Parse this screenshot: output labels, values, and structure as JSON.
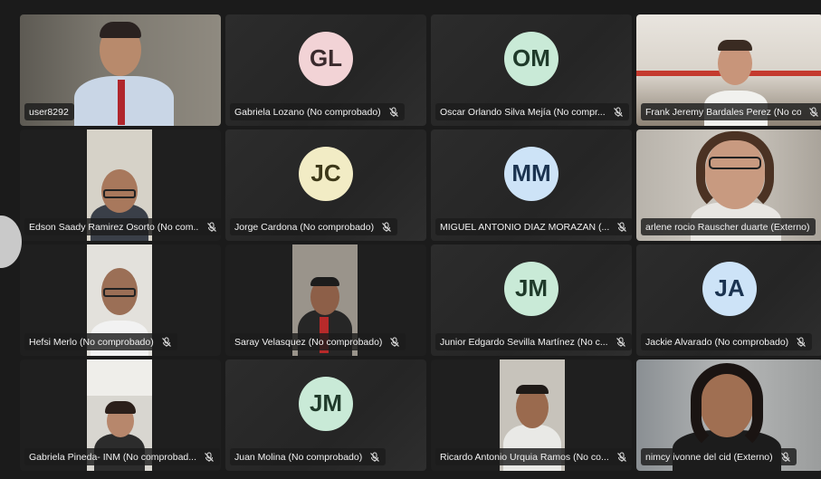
{
  "meeting": {
    "participants": [
      {
        "name": "user8292",
        "initials": "",
        "muted": false,
        "type": "video"
      },
      {
        "name": "Gabriela Lozano (No comprobado)",
        "initials": "GL",
        "muted": true,
        "type": "avatar",
        "avatar_bg": "#f2d3d6",
        "avatar_fg": "#3a2a2d"
      },
      {
        "name": "Oscar Orlando Silva Mejía (No compr...",
        "initials": "OM",
        "muted": true,
        "type": "avatar",
        "avatar_bg": "#c9ead7",
        "avatar_fg": "#1f3a2a"
      },
      {
        "name": "Frank Jeremy Bardales Perez (No com...",
        "initials": "",
        "muted": true,
        "type": "video"
      },
      {
        "name": "Edson Saady Ramirez Osorto (No com...",
        "initials": "",
        "muted": true,
        "type": "video"
      },
      {
        "name": "Jorge Cardona (No comprobado)",
        "initials": "JC",
        "muted": true,
        "type": "avatar",
        "avatar_bg": "#f2ecc5",
        "avatar_fg": "#3d3819"
      },
      {
        "name": "MIGUEL ANTONIO DIAZ MORAZAN (...",
        "initials": "MM",
        "muted": true,
        "type": "avatar",
        "avatar_bg": "#cde3f7",
        "avatar_fg": "#1b3350"
      },
      {
        "name": "arlene rocio Rauscher duarte (Externo)",
        "initials": "",
        "muted": false,
        "type": "video"
      },
      {
        "name": "Hefsi Merlo (No comprobado)",
        "initials": "",
        "muted": true,
        "type": "video"
      },
      {
        "name": "Saray Velasquez (No comprobado)",
        "initials": "",
        "muted": true,
        "type": "video"
      },
      {
        "name": "Junior Edgardo Sevilla Martínez (No c...",
        "initials": "JM",
        "muted": true,
        "type": "avatar",
        "avatar_bg": "#c9ead7",
        "avatar_fg": "#1f3a2a"
      },
      {
        "name": "Jackie Alvarado (No comprobado)",
        "initials": "JA",
        "muted": true,
        "type": "avatar",
        "avatar_bg": "#cde3f7",
        "avatar_fg": "#1b3350"
      },
      {
        "name": "Gabriela Pineda- INM (No comprobad...",
        "initials": "",
        "muted": true,
        "type": "video"
      },
      {
        "name": "Juan Molina (No comprobado)",
        "initials": "JM",
        "muted": true,
        "type": "avatar",
        "avatar_bg": "#c9ead7",
        "avatar_fg": "#1f3a2a"
      },
      {
        "name": "Ricardo Antonio Urquia Ramos (No co...",
        "initials": "",
        "muted": true,
        "type": "video"
      },
      {
        "name": "nimcy ivonne del cid (Externo)",
        "initials": "",
        "muted": true,
        "type": "video"
      }
    ]
  }
}
